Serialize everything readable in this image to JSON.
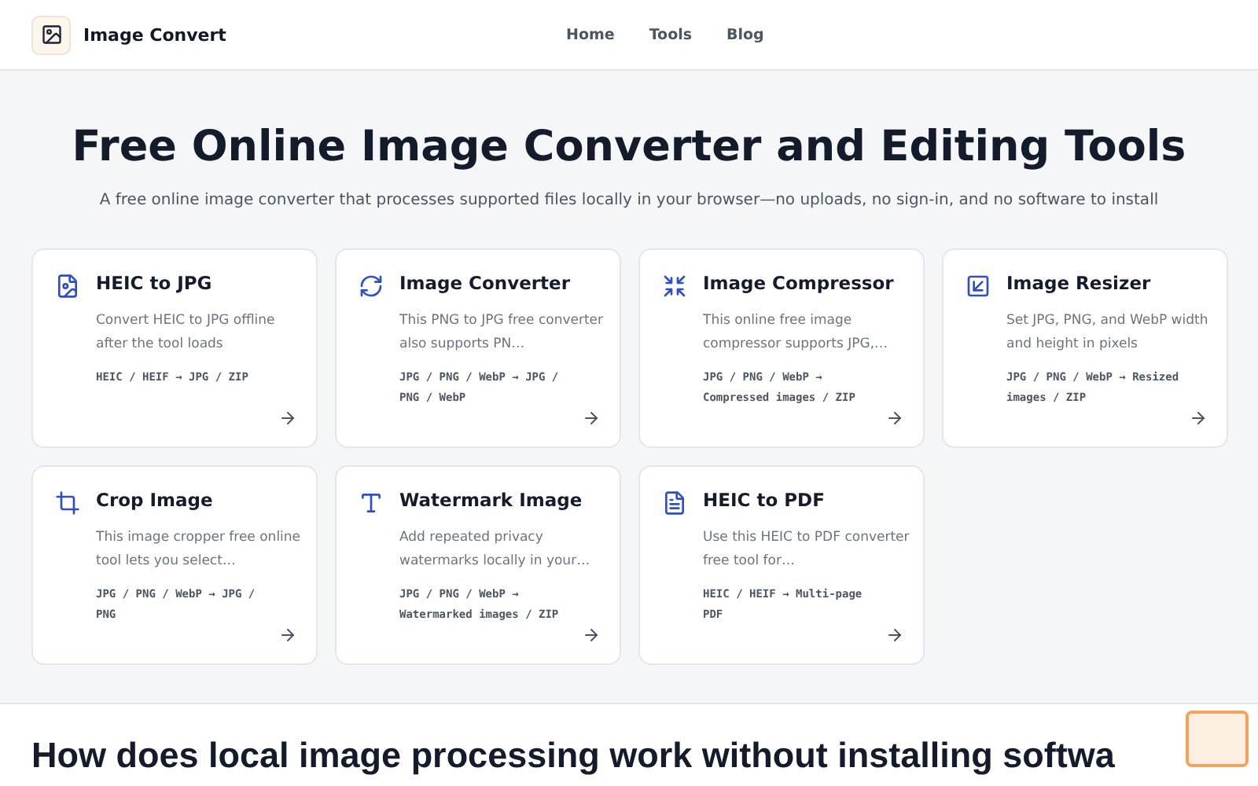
{
  "header": {
    "brand": "Image Convert",
    "nav": [
      {
        "label": "Home"
      },
      {
        "label": "Tools"
      },
      {
        "label": "Blog"
      }
    ]
  },
  "hero": {
    "title": "Free Online Image Converter and Editing Tools",
    "subtitle": "A free online image converter that processes supported files locally in your browser—no uploads, no sign-in, and no software to install"
  },
  "tools": [
    {
      "kind": "file-image",
      "title": "HEIC to JPG",
      "description": "Convert HEIC to JPG offline after the tool loads",
      "formats": "HEIC / HEIF → JPG / ZIP"
    },
    {
      "kind": "refresh",
      "title": "Image Converter",
      "description": "This PNG to JPG free converter also supports PN…",
      "formats": "JPG / PNG / WebP → JPG / PNG / WebP"
    },
    {
      "kind": "shrink",
      "title": "Image Compressor",
      "description": "This online free image compressor supports JPG,…",
      "formats": "JPG / PNG / WebP → Compressed images / ZIP"
    },
    {
      "kind": "resize",
      "title": "Image Resizer",
      "description": "Set JPG, PNG, and WebP width and height in pixels",
      "formats": "JPG / PNG / WebP → Resized images / ZIP"
    },
    {
      "kind": "crop",
      "title": "Crop Image",
      "description": "This image cropper free online tool lets you select…",
      "formats": "JPG / PNG / WebP → JPG / PNG"
    },
    {
      "kind": "type",
      "title": "Watermark Image",
      "description": "Add repeated privacy watermarks locally in your…",
      "formats": "JPG / PNG / WebP → Watermarked images / ZIP"
    },
    {
      "kind": "file-text",
      "title": "HEIC to PDF",
      "description": "Use this HEIC to PDF converter free tool for…",
      "formats": "HEIC / HEIF → Multi-page PDF"
    }
  ],
  "section": {
    "heading": "How does local image processing work without installing softwa"
  }
}
